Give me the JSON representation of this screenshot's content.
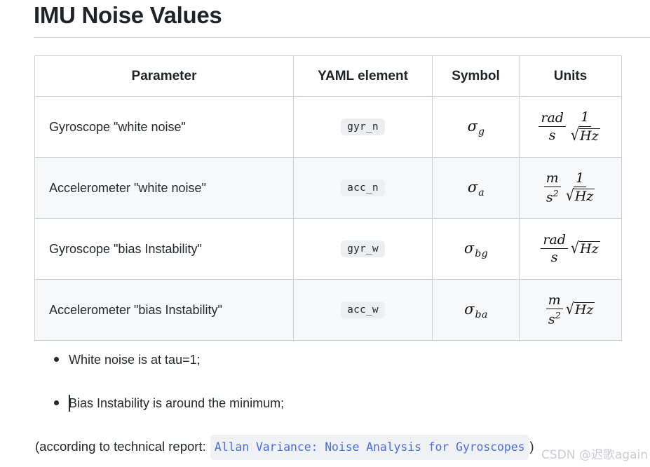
{
  "document": {
    "title": "IMU Noise Values"
  },
  "table": {
    "headers": [
      "Parameter",
      "YAML element",
      "Symbol",
      "Units"
    ],
    "rows": [
      {
        "parameter": "Gyroscope \"white noise\"",
        "yaml_element": "gyr_n",
        "symbol_base": "σ",
        "symbol_sub": "g",
        "units_text": "rad/s · 1/√Hz",
        "units": {
          "frac1_num": "rad",
          "frac1_den": "s",
          "frac2_num": "1",
          "frac2_den_radicand": "Hz"
        }
      },
      {
        "parameter": "Accelerometer \"white noise\"",
        "yaml_element": "acc_n",
        "symbol_base": "σ",
        "symbol_sub": "a",
        "units_text": "m/s² · 1/√Hz",
        "units": {
          "frac1_num": "m",
          "frac1_den": "s",
          "frac1_den_sup": "2",
          "frac2_num": "1",
          "frac2_den_radicand": "Hz"
        }
      },
      {
        "parameter": "Gyroscope \"bias Instability\"",
        "yaml_element": "gyr_w",
        "symbol_base": "σ",
        "symbol_sub": "bg",
        "units_text": "rad/s · √Hz",
        "units": {
          "frac1_num": "rad",
          "frac1_den": "s",
          "radicand": "Hz"
        }
      },
      {
        "parameter": "Accelerometer \"bias Instability\"",
        "yaml_element": "acc_w",
        "symbol_base": "σ",
        "symbol_sub": "ba",
        "units_text": "m/s² · √Hz",
        "units": {
          "frac1_num": "m",
          "frac1_den": "s",
          "frac1_den_sup": "2",
          "radicand": "Hz"
        }
      }
    ]
  },
  "notes": [
    "White noise is at tau=1;",
    "Bias Instability is around the minimum;"
  ],
  "footer": {
    "prefix": "(according to technical report:",
    "link_label": "Allan Variance: Noise Analysis for Gyroscopes",
    "suffix": ")"
  },
  "watermark": "CSDN @迟歌again",
  "colors": {
    "link": "#4a6ee0",
    "border": "#ccd1d9",
    "row_alt": "#f6f8fa",
    "code_chip_bg": "#eceef2",
    "link_bg": "#f0f1f5",
    "text": "#24292f"
  }
}
